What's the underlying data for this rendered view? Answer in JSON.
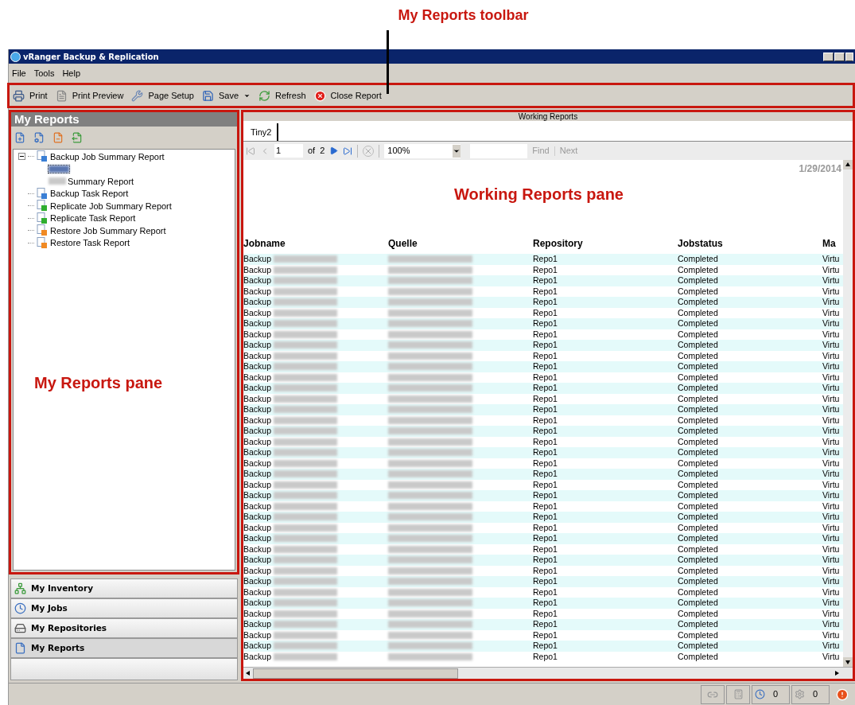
{
  "annotations": {
    "toolbar": "My Reports toolbar",
    "reports_pane": "My Reports pane",
    "working_pane": "Working Reports pane"
  },
  "window": {
    "title": "vRanger Backup & Replication"
  },
  "menu": [
    "File",
    "Tools",
    "Help"
  ],
  "toolbar": [
    {
      "label": "Print",
      "kind": "print",
      "dropdown": false
    },
    {
      "label": "Print Preview",
      "kind": "preview",
      "dropdown": false
    },
    {
      "label": "Page Setup",
      "kind": "setup",
      "dropdown": false
    },
    {
      "label": "Save",
      "kind": "save",
      "dropdown": true
    },
    {
      "label": "Refresh",
      "kind": "refresh",
      "dropdown": false
    },
    {
      "label": "Close Report",
      "kind": "close",
      "dropdown": false
    }
  ],
  "my_reports": {
    "title": "My Reports",
    "tree": [
      {
        "label": "Backup Job Summary Report",
        "color": "#3a7fd5",
        "expanded": true,
        "children": [
          {
            "kind": "hidden_name",
            "selected": true
          },
          {
            "kind": "named",
            "label": "Summary Report",
            "selected": false
          }
        ]
      },
      {
        "label": "Backup Task Report",
        "color": "#3a7fd5"
      },
      {
        "label": "Replicate Job Summary Report",
        "color": "#2fae2f"
      },
      {
        "label": "Replicate Task Report",
        "color": "#2fae2f"
      },
      {
        "label": "Restore Job Summary Report",
        "color": "#f08a24"
      },
      {
        "label": "Restore Task Report",
        "color": "#f08a24"
      }
    ]
  },
  "nav": [
    {
      "label": "My Inventory",
      "kind": "inventory",
      "selected": false
    },
    {
      "label": "My Jobs",
      "kind": "jobs",
      "selected": false
    },
    {
      "label": "My Repositories",
      "kind": "repositories",
      "selected": false
    },
    {
      "label": "My Reports",
      "kind": "reports",
      "selected": true
    }
  ],
  "working_reports": {
    "title": "Working Reports",
    "tabs": [
      {
        "label": "Tiny2",
        "selected": true
      }
    ],
    "pager": {
      "page": "1",
      "of": "of",
      "total": "2",
      "zoom": "100%",
      "find": "Find",
      "next": "Next"
    },
    "date": "1/29/2014",
    "columns": [
      "Jobname",
      "Quelle",
      "Repository",
      "Jobstatus",
      "Ma"
    ],
    "rows": [
      {
        "jobname": "Backup",
        "repository": "Repo1",
        "jobstatus": "Completed",
        "column_5": "Virtu"
      },
      {
        "jobname": "Backup",
        "repository": "Repo1",
        "jobstatus": "Completed",
        "column_5": "Virtu"
      },
      {
        "jobname": "Backup",
        "repository": "Repo1",
        "jobstatus": "Completed",
        "column_5": "Virtu"
      },
      {
        "jobname": "Backup",
        "repository": "Repo1",
        "jobstatus": "Completed",
        "column_5": "Virtu"
      },
      {
        "jobname": "Backup",
        "repository": "Repo1",
        "jobstatus": "Completed",
        "column_5": "Virtu"
      },
      {
        "jobname": "Backup",
        "repository": "Repo1",
        "jobstatus": "Completed",
        "column_5": "Virtu"
      },
      {
        "jobname": "Backup",
        "repository": "Repo1",
        "jobstatus": "Completed",
        "column_5": "Virtu"
      },
      {
        "jobname": "Backup",
        "repository": "Repo1",
        "jobstatus": "Completed",
        "column_5": "Virtu"
      },
      {
        "jobname": "Backup",
        "repository": "Repo1",
        "jobstatus": "Completed",
        "column_5": "Virtu"
      },
      {
        "jobname": "Backup",
        "repository": "Repo1",
        "jobstatus": "Completed",
        "column_5": "Virtu"
      },
      {
        "jobname": "Backup",
        "repository": "Repo1",
        "jobstatus": "Completed",
        "column_5": "Virtu"
      },
      {
        "jobname": "Backup",
        "repository": "Repo1",
        "jobstatus": "Completed",
        "column_5": "Virtu"
      },
      {
        "jobname": "Backup",
        "repository": "Repo1",
        "jobstatus": "Completed",
        "column_5": "Virtu"
      },
      {
        "jobname": "Backup",
        "repository": "Repo1",
        "jobstatus": "Completed",
        "column_5": "Virtu"
      },
      {
        "jobname": "Backup",
        "repository": "Repo1",
        "jobstatus": "Completed",
        "column_5": "Virtu"
      },
      {
        "jobname": "Backup",
        "repository": "Repo1",
        "jobstatus": "Completed",
        "column_5": "Virtu"
      },
      {
        "jobname": "Backup",
        "repository": "Repo1",
        "jobstatus": "Completed",
        "column_5": "Virtu"
      },
      {
        "jobname": "Backup",
        "repository": "Repo1",
        "jobstatus": "Completed",
        "column_5": "Virtu"
      },
      {
        "jobname": "Backup",
        "repository": "Repo1",
        "jobstatus": "Completed",
        "column_5": "Virtu"
      },
      {
        "jobname": "Backup",
        "repository": "Repo1",
        "jobstatus": "Completed",
        "column_5": "Virtu"
      },
      {
        "jobname": "Backup",
        "repository": "Repo1",
        "jobstatus": "Completed",
        "column_5": "Virtu"
      },
      {
        "jobname": "Backup",
        "repository": "Repo1",
        "jobstatus": "Completed",
        "column_5": "Virtu"
      },
      {
        "jobname": "Backup",
        "repository": "Repo1",
        "jobstatus": "Completed",
        "column_5": "Virtu"
      },
      {
        "jobname": "Backup",
        "repository": "Repo1",
        "jobstatus": "Completed",
        "column_5": "Virtu"
      },
      {
        "jobname": "Backup",
        "repository": "Repo1",
        "jobstatus": "Completed",
        "column_5": "Virtu"
      },
      {
        "jobname": "Backup",
        "repository": "Repo1",
        "jobstatus": "Completed",
        "column_5": "Virtu"
      },
      {
        "jobname": "Backup",
        "repository": "Repo1",
        "jobstatus": "Completed",
        "column_5": "Virtu"
      },
      {
        "jobname": "Backup",
        "repository": "Repo1",
        "jobstatus": "Completed",
        "column_5": "Virtu"
      },
      {
        "jobname": "Backup",
        "repository": "Repo1",
        "jobstatus": "Completed",
        "column_5": "Virtu"
      },
      {
        "jobname": "Backup",
        "repository": "Repo1",
        "jobstatus": "Completed",
        "column_5": "Virtu"
      },
      {
        "jobname": "Backup",
        "repository": "Repo1",
        "jobstatus": "Completed",
        "column_5": "Virtu"
      },
      {
        "jobname": "Backup",
        "repository": "Repo1",
        "jobstatus": "Completed",
        "column_5": "Virtu"
      },
      {
        "jobname": "Backup",
        "repository": "Repo1",
        "jobstatus": "Completed",
        "column_5": "Virtu"
      },
      {
        "jobname": "Backup",
        "repository": "Repo1",
        "jobstatus": "Completed",
        "column_5": "Virtu"
      },
      {
        "jobname": "Backup",
        "repository": "Repo1",
        "jobstatus": "Completed",
        "column_5": "Virtu"
      },
      {
        "jobname": "Backup",
        "repository": "Repo1",
        "jobstatus": "Completed",
        "column_5": "Virtu"
      },
      {
        "jobname": "Backup",
        "repository": "Repo1",
        "jobstatus": "Completed",
        "column_5": "Virtu"
      },
      {
        "jobname": "Backup",
        "repository": "Repo1",
        "jobstatus": "Completed",
        "column_5": "Virtu"
      }
    ]
  },
  "status_bar": {
    "jobs_count": "0",
    "tasks_count": "0"
  }
}
